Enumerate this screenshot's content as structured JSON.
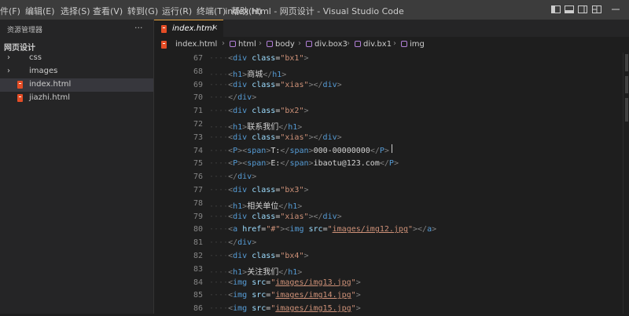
{
  "menu": [
    "件(F)",
    "编辑(E)",
    "选择(S)",
    "查看(V)",
    "转到(G)",
    "运行(R)",
    "终端(T)",
    "帮助(H)"
  ],
  "window_title": "index.html - 网页设计 - Visual Studio Code",
  "sidebar": {
    "header": "资源管理器",
    "more": "···",
    "folder": "网页设计",
    "items": [
      {
        "label": "css",
        "type": "folder"
      },
      {
        "label": "images",
        "type": "folder"
      },
      {
        "label": "index.html",
        "type": "html",
        "active": true
      },
      {
        "label": "jiazhi.html",
        "type": "html"
      }
    ]
  },
  "tab": {
    "label": "index.html",
    "close": "×"
  },
  "breadcrumb": [
    "index.html",
    "html",
    "body",
    "div.box3",
    "div.bx1",
    "img"
  ],
  "code_lines": [
    {
      "n": 67,
      "indent": 2,
      "tokens": [
        [
          "brk",
          "<"
        ],
        [
          "tag",
          "div"
        ],
        [
          "d",
          " "
        ],
        [
          "attr",
          "class"
        ],
        [
          "d",
          "="
        ],
        [
          "str",
          "\"bx1\""
        ],
        [
          "brk",
          ">"
        ]
      ]
    },
    {
      "n": 68,
      "indent": 2,
      "tokens": [
        [
          "brk",
          "<"
        ],
        [
          "tag",
          "h1"
        ],
        [
          "brk",
          ">"
        ],
        [
          "d",
          "商城"
        ],
        [
          "brk",
          "</"
        ],
        [
          "tag",
          "h1"
        ],
        [
          "brk",
          ">"
        ]
      ]
    },
    {
      "n": 69,
      "indent": 2,
      "tokens": [
        [
          "brk",
          "<"
        ],
        [
          "tag",
          "div"
        ],
        [
          "d",
          " "
        ],
        [
          "attr",
          "class"
        ],
        [
          "d",
          "="
        ],
        [
          "str",
          "\"xias\""
        ],
        [
          "brk",
          "></"
        ],
        [
          "tag",
          "div"
        ],
        [
          "brk",
          ">"
        ]
      ]
    },
    {
      "n": 70,
      "indent": 2,
      "tokens": [
        [
          "brk",
          "</"
        ],
        [
          "tag",
          "div"
        ],
        [
          "brk",
          ">"
        ]
      ]
    },
    {
      "n": 71,
      "indent": 2,
      "tokens": [
        [
          "brk",
          "<"
        ],
        [
          "tag",
          "div"
        ],
        [
          "d",
          " "
        ],
        [
          "attr",
          "class"
        ],
        [
          "d",
          "="
        ],
        [
          "str",
          "\"bx2\""
        ],
        [
          "brk",
          ">"
        ]
      ]
    },
    {
      "n": 72,
      "indent": 2,
      "tokens": [
        [
          "brk",
          "<"
        ],
        [
          "tag",
          "h1"
        ],
        [
          "brk",
          ">"
        ],
        [
          "d",
          "联系我们"
        ],
        [
          "brk",
          "</"
        ],
        [
          "tag",
          "h1"
        ],
        [
          "brk",
          ">"
        ]
      ]
    },
    {
      "n": 73,
      "indent": 2,
      "tokens": [
        [
          "brk",
          "<"
        ],
        [
          "tag",
          "div"
        ],
        [
          "d",
          " "
        ],
        [
          "attr",
          "class"
        ],
        [
          "d",
          "="
        ],
        [
          "str",
          "\"xias\""
        ],
        [
          "brk",
          "></"
        ],
        [
          "tag",
          "div"
        ],
        [
          "brk",
          ">"
        ]
      ]
    },
    {
      "n": 74,
      "indent": 2,
      "tokens": [
        [
          "brk",
          "<"
        ],
        [
          "tag",
          "P"
        ],
        [
          "brk",
          ">"
        ],
        [
          "brk",
          "<"
        ],
        [
          "tag",
          "span"
        ],
        [
          "brk",
          ">"
        ],
        [
          "d",
          "T:"
        ],
        [
          "brk",
          "</"
        ],
        [
          "tag",
          "span"
        ],
        [
          "brk",
          ">"
        ],
        [
          "d",
          "000-00000000"
        ],
        [
          "brk",
          "</"
        ],
        [
          "tag",
          "P"
        ],
        [
          "brk",
          ">"
        ]
      ]
    },
    {
      "n": 75,
      "indent": 2,
      "tokens": [
        [
          "brk",
          "<"
        ],
        [
          "tag",
          "P"
        ],
        [
          "brk",
          ">"
        ],
        [
          "brk",
          "<"
        ],
        [
          "tag",
          "span"
        ],
        [
          "brk",
          ">"
        ],
        [
          "d",
          "E:"
        ],
        [
          "brk",
          "</"
        ],
        [
          "tag",
          "span"
        ],
        [
          "brk",
          ">"
        ],
        [
          "d",
          "ibaotu@123.com"
        ],
        [
          "brk",
          "</"
        ],
        [
          "tag",
          "P"
        ],
        [
          "brk",
          ">"
        ]
      ]
    },
    {
      "n": 76,
      "indent": 2,
      "tokens": [
        [
          "brk",
          "</"
        ],
        [
          "tag",
          "div"
        ],
        [
          "brk",
          ">"
        ]
      ]
    },
    {
      "n": 77,
      "indent": 2,
      "tokens": [
        [
          "brk",
          "<"
        ],
        [
          "tag",
          "div"
        ],
        [
          "d",
          " "
        ],
        [
          "attr",
          "class"
        ],
        [
          "d",
          "="
        ],
        [
          "str",
          "\"bx3\""
        ],
        [
          "brk",
          ">"
        ]
      ]
    },
    {
      "n": 78,
      "indent": 2,
      "tokens": [
        [
          "brk",
          "<"
        ],
        [
          "tag",
          "h1"
        ],
        [
          "brk",
          ">"
        ],
        [
          "d",
          "相关单位"
        ],
        [
          "brk",
          "</"
        ],
        [
          "tag",
          "h1"
        ],
        [
          "brk",
          ">"
        ]
      ]
    },
    {
      "n": 79,
      "indent": 2,
      "tokens": [
        [
          "brk",
          "<"
        ],
        [
          "tag",
          "div"
        ],
        [
          "d",
          " "
        ],
        [
          "attr",
          "class"
        ],
        [
          "d",
          "="
        ],
        [
          "str",
          "\"xias\""
        ],
        [
          "brk",
          "></"
        ],
        [
          "tag",
          "div"
        ],
        [
          "brk",
          ">"
        ]
      ]
    },
    {
      "n": 80,
      "indent": 2,
      "tokens": [
        [
          "brk",
          "<"
        ],
        [
          "tag",
          "a"
        ],
        [
          "d",
          " "
        ],
        [
          "attr",
          "href"
        ],
        [
          "d",
          "="
        ],
        [
          "str",
          "\"#\""
        ],
        [
          "brk",
          "><"
        ],
        [
          "tag",
          "img"
        ],
        [
          "d",
          " "
        ],
        [
          "attr",
          "src"
        ],
        [
          "d",
          "="
        ],
        [
          "str",
          "\""
        ],
        [
          "strl",
          "images/img12.jpg"
        ],
        [
          "str",
          "\""
        ],
        [
          "brk",
          "></"
        ],
        [
          "tag",
          "a"
        ],
        [
          "brk",
          ">"
        ]
      ]
    },
    {
      "n": 81,
      "indent": 2,
      "tokens": [
        [
          "brk",
          "</"
        ],
        [
          "tag",
          "div"
        ],
        [
          "brk",
          ">"
        ]
      ]
    },
    {
      "n": 82,
      "indent": 2,
      "tokens": [
        [
          "brk",
          "<"
        ],
        [
          "tag",
          "div"
        ],
        [
          "d",
          " "
        ],
        [
          "attr",
          "class"
        ],
        [
          "d",
          "="
        ],
        [
          "str",
          "\"bx4\""
        ],
        [
          "brk",
          ">"
        ]
      ]
    },
    {
      "n": 83,
      "indent": 2,
      "tokens": [
        [
          "brk",
          "<"
        ],
        [
          "tag",
          "h1"
        ],
        [
          "brk",
          ">"
        ],
        [
          "d",
          "关注我们"
        ],
        [
          "brk",
          "</"
        ],
        [
          "tag",
          "h1"
        ],
        [
          "brk",
          ">"
        ]
      ]
    },
    {
      "n": 84,
      "indent": 2,
      "tokens": [
        [
          "brk",
          "<"
        ],
        [
          "tag",
          "img"
        ],
        [
          "d",
          " "
        ],
        [
          "attr",
          "src"
        ],
        [
          "d",
          "="
        ],
        [
          "str",
          "\""
        ],
        [
          "strl",
          "images/img13.jpg"
        ],
        [
          "str",
          "\""
        ],
        [
          "brk",
          ">"
        ]
      ]
    },
    {
      "n": 85,
      "indent": 2,
      "tokens": [
        [
          "brk",
          "<"
        ],
        [
          "tag",
          "img"
        ],
        [
          "d",
          " "
        ],
        [
          "attr",
          "src"
        ],
        [
          "d",
          "="
        ],
        [
          "str",
          "\""
        ],
        [
          "strl",
          "images/img14.jpg"
        ],
        [
          "str",
          "\""
        ],
        [
          "brk",
          ">"
        ]
      ]
    },
    {
      "n": 86,
      "indent": 2,
      "tokens": [
        [
          "brk",
          "<"
        ],
        [
          "tag",
          "img"
        ],
        [
          "d",
          " "
        ],
        [
          "attr",
          "src"
        ],
        [
          "d",
          "="
        ],
        [
          "str",
          "\""
        ],
        [
          "strl",
          "images/img15.jpg"
        ],
        [
          "str",
          "\""
        ],
        [
          "brk",
          ">"
        ]
      ]
    }
  ]
}
